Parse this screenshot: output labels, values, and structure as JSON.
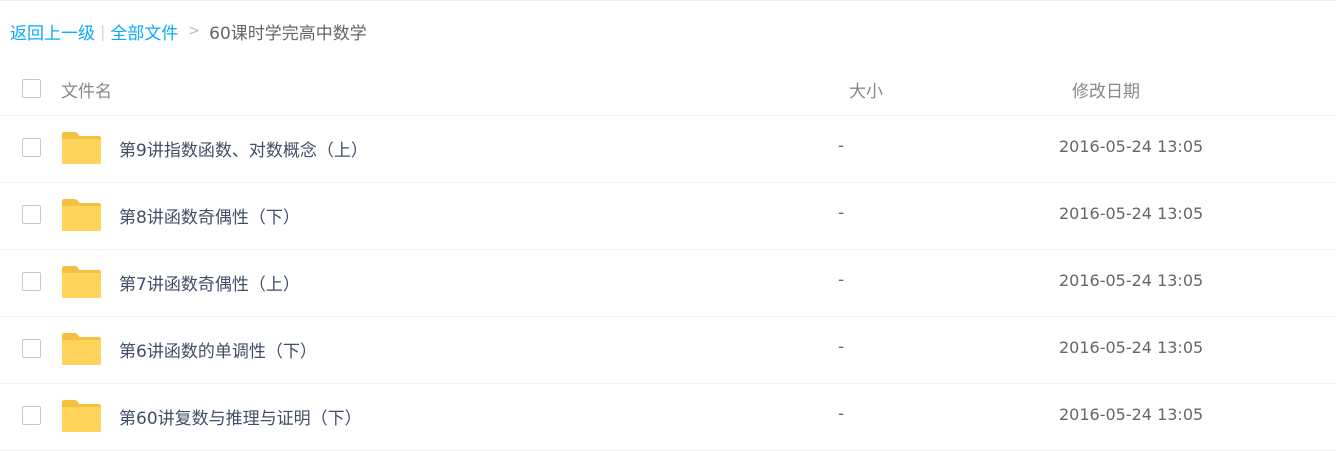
{
  "breadcrumb": {
    "back_label": "返回上一级",
    "separator": "|",
    "all_files_label": "全部文件",
    "arrow": ">",
    "current_label": "60课时学完高中数学"
  },
  "table": {
    "headers": {
      "name": "文件名",
      "size": "大小",
      "modified": "修改日期"
    },
    "rows": [
      {
        "name": "第9讲指数函数、对数概念（上）",
        "size": "-",
        "modified": "2016-05-24 13:05",
        "icon": "folder-icon"
      },
      {
        "name": "第8讲函数奇偶性（下）",
        "size": "-",
        "modified": "2016-05-24 13:05",
        "icon": "folder-icon"
      },
      {
        "name": "第7讲函数奇偶性（上）",
        "size": "-",
        "modified": "2016-05-24 13:05",
        "icon": "folder-icon"
      },
      {
        "name": "第6讲函数的单调性（下）",
        "size": "-",
        "modified": "2016-05-24 13:05",
        "icon": "folder-icon"
      },
      {
        "name": "第60讲复数与推理与证明（下）",
        "size": "-",
        "modified": "2016-05-24 13:05",
        "icon": "folder-icon"
      }
    ]
  },
  "colors": {
    "link": "#09aaff",
    "folder": "#ffd35c",
    "folder_tab": "#f5c040",
    "text": "#424e67",
    "muted": "#888888"
  }
}
